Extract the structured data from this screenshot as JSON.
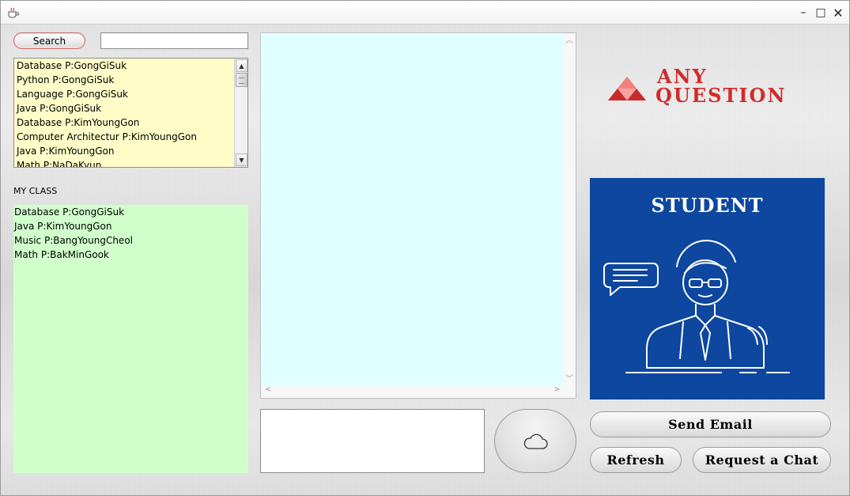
{
  "window": {
    "title": "",
    "controls": {
      "minimize": "–",
      "maximize": "□",
      "close": "✕"
    }
  },
  "search": {
    "button_label": "Search",
    "input_value": "",
    "input_placeholder": ""
  },
  "course_list": {
    "items": [
      "Database P:GongGiSuk",
      "Python P:GongGiSuk",
      "Language P:GongGiSuk",
      "Java P:GongGiSuk",
      "Database P:KimYoungGon",
      "Computer Architectur P:KimYoungGon",
      "Java P:KimYoungGon",
      "Math P:NaDaKyun"
    ],
    "background": "#fffcc8"
  },
  "my_class": {
    "label": "MY CLASS",
    "items": [
      "Database P:GongGiSuk",
      "Java P:KimYoungGon",
      "Music P:BangYoungCheol",
      "Math P:BakMinGook"
    ],
    "background": "#d0ffcc"
  },
  "chat": {
    "background": "#e0ffff",
    "message_input_value": ""
  },
  "upload_button": {
    "icon": "cloud-icon"
  },
  "logo": {
    "line1": "ANY",
    "line2": "QUESTION",
    "color": "#d12b2b",
    "icon": "pyramid-logo-icon"
  },
  "student_card": {
    "title": "STUDENT",
    "background": "#0d479f",
    "icon": "student-chat-illustration"
  },
  "buttons": {
    "send_email": "Send Email",
    "refresh": "Refresh",
    "request_chat": "Request a Chat"
  }
}
